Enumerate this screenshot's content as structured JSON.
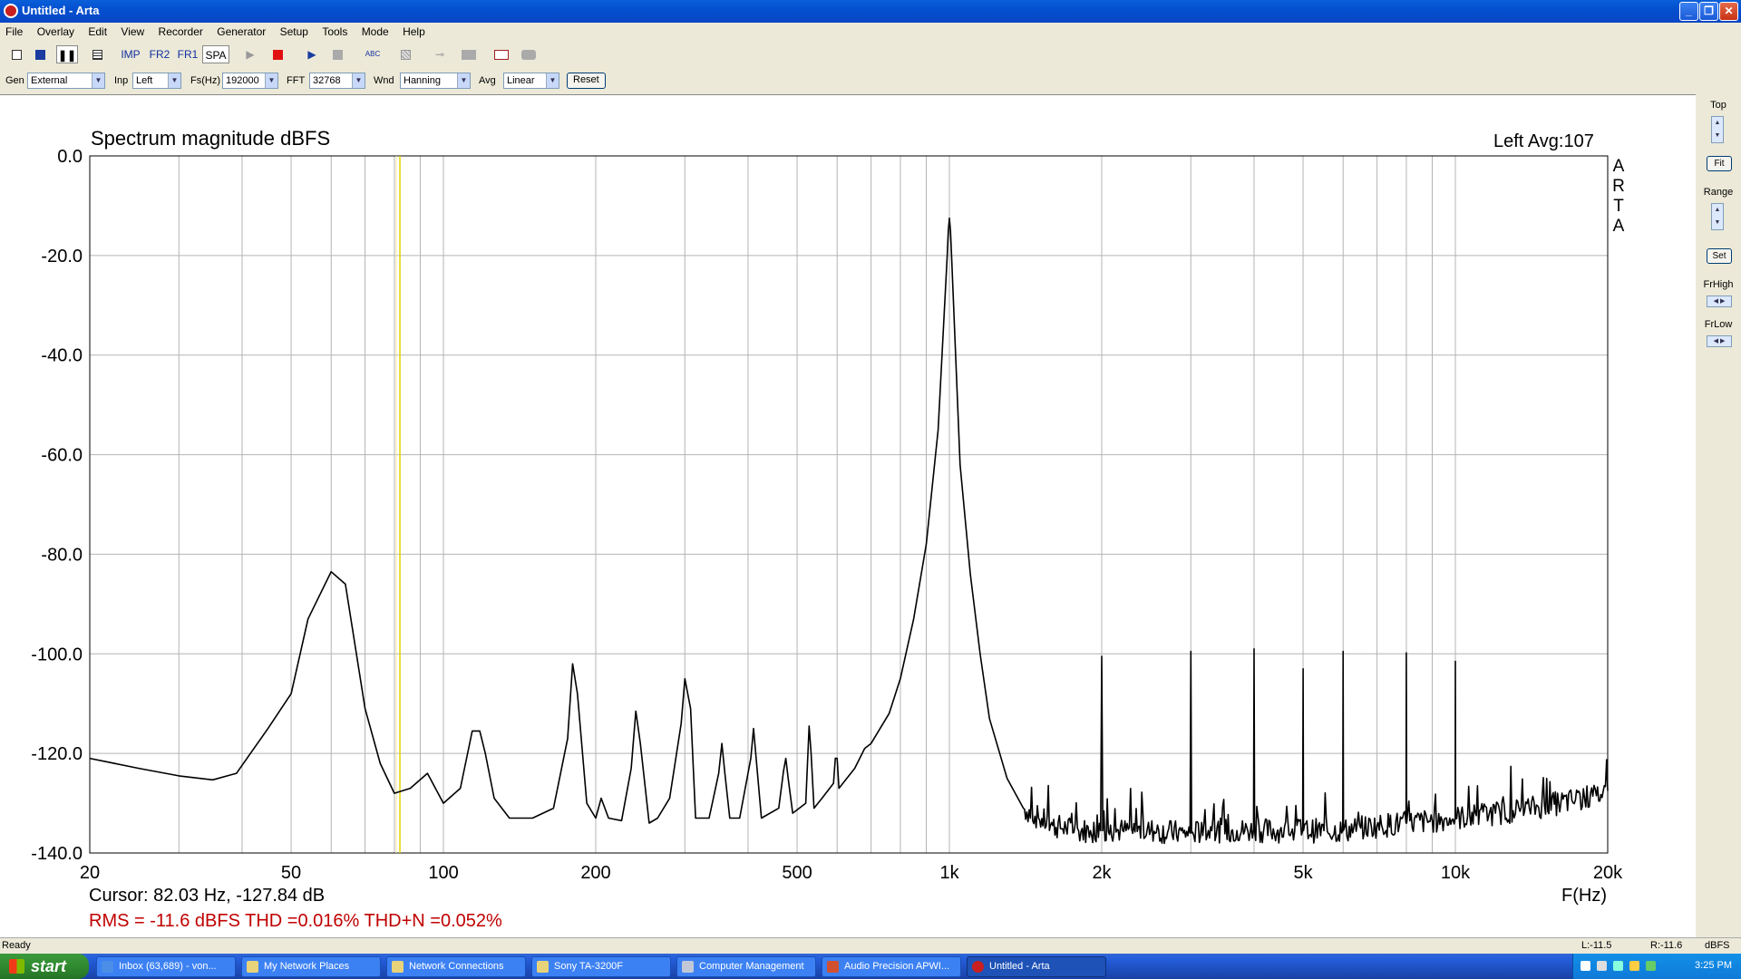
{
  "window": {
    "title": "Untitled - Arta",
    "btn_min": "_",
    "btn_max": "❐",
    "btn_close": "✕"
  },
  "menu": [
    "File",
    "Overlay",
    "Edit",
    "View",
    "Recorder",
    "Generator",
    "Setup",
    "Tools",
    "Mode",
    "Help"
  ],
  "toolbar": {
    "imp": "IMP",
    "fr2": "FR2",
    "fr1": "FR1",
    "spa": "SPA",
    "abc": "ABC"
  },
  "params": {
    "gen_label": "Gen",
    "gen_value": "External",
    "inp_label": "Inp",
    "inp_value": "Left",
    "fs_label": "Fs(Hz)",
    "fs_value": "192000",
    "fft_label": "FFT",
    "fft_value": "32768",
    "wnd_label": "Wnd",
    "wnd_value": "Hanning",
    "avg_label": "Avg",
    "avg_value": "Linear",
    "reset_label": "Reset"
  },
  "plot": {
    "title": "Spectrum magnitude dBFS",
    "status": "Left  Avg:107",
    "brand": [
      "A",
      "R",
      "T",
      "A"
    ],
    "cursor": "Cursor: 82.03 Hz, -127.84 dB",
    "measurements": "RMS =  -11.6 dBFS  THD =0.016%  THD+N =0.052%",
    "x_unit": "F(Hz)"
  },
  "right_panel": {
    "top": "Top",
    "fit": "Fit",
    "range": "Range",
    "set": "Set",
    "frhigh": "FrHigh",
    "frlow": "FrLow"
  },
  "statusbar": {
    "left": "Ready",
    "l_level": "L:-11.5",
    "r_level": "R:-11.6",
    "unit": "dBFS"
  },
  "taskbar": {
    "start": "start",
    "tasks": [
      "Inbox (63,689) - von...",
      "My Network Places",
      "Network Connections",
      "Sony TA-3200F",
      "Computer Management",
      "Audio Precision APWI...",
      "Untitled - Arta"
    ],
    "clock": "3:25 PM"
  },
  "colors": {
    "cursor_line": "#e6d200",
    "grid": "#b4b4b4",
    "trace": "#000000",
    "meas_text": "#c00000"
  },
  "chart_data": {
    "type": "line",
    "x_scale": "log",
    "xlim": [
      20,
      20000
    ],
    "ylim": [
      -140,
      0
    ],
    "x_ticks": [
      20,
      50,
      100,
      200,
      500,
      1000,
      2000,
      5000,
      10000,
      20000
    ],
    "x_tick_labels": [
      "20",
      "50",
      "100",
      "200",
      "500",
      "1k",
      "2k",
      "5k",
      "10k",
      "20k"
    ],
    "y_ticks": [
      0,
      -20,
      -40,
      -60,
      -80,
      -100,
      -120,
      -140
    ],
    "y_tick_labels": [
      "0.0",
      "-20.0",
      "-40.0",
      "-60.0",
      "-80.0",
      "-100.0",
      "-120.0",
      "-140.0"
    ],
    "cursor_hz": 82.03,
    "grid": true,
    "series": [
      {
        "x": [
          20,
          25,
          30,
          35,
          39,
          45,
          50,
          54,
          60,
          64,
          70,
          75,
          80,
          86,
          93,
          100,
          108,
          114,
          118,
          121,
          126,
          135,
          150,
          165,
          176,
          180,
          184,
          192,
          200,
          205,
          212,
          225,
          235,
          240,
          245,
          255,
          265,
          280,
          295,
          300,
          308,
          315,
          335,
          350,
          355,
          360,
          368,
          385,
          405,
          410,
          415,
          425,
          460,
          470,
          475,
          480,
          490,
          520,
          528,
          533,
          540,
          560,
          590,
          595,
          600,
          605,
          650,
          680,
          700,
          760,
          800,
          850,
          900,
          950,
          990,
          995,
          1000,
          1005,
          1010,
          1050,
          1100,
          1150,
          1200,
          1300,
          1400,
          1500,
          1600,
          1700,
          1800,
          1900,
          1990,
          2000,
          2010,
          2200,
          2500,
          2900,
          2990,
          3000,
          3010,
          3300,
          3700,
          3990,
          4000,
          4010,
          4500,
          4990,
          5000,
          5010,
          5500,
          5990,
          6000,
          6010,
          6500,
          7000,
          7990,
          8000,
          8010,
          9000,
          9990,
          10000,
          10010,
          11000,
          12000,
          13000,
          14000,
          15000,
          16000,
          17000,
          18000,
          19000,
          20000
        ],
        "y": [
          -121,
          -123,
          -124.5,
          -125.3,
          -124,
          -115,
          -108,
          -93,
          -83.5,
          -86,
          -111,
          -122,
          -128,
          -127,
          -124,
          -130,
          -127,
          -115.5,
          -115.5,
          -120,
          -129,
          -133,
          -133,
          -131,
          -117,
          -102,
          -108,
          -130,
          -133,
          -129,
          -133,
          -133.5,
          -123,
          -111.5,
          -118,
          -134,
          -133,
          -129,
          -114,
          -105,
          -111,
          -133,
          -133,
          -124,
          -118,
          -124,
          -133,
          -133,
          -121,
          -115,
          -121,
          -133,
          -131,
          -123.5,
          -121,
          -125,
          -132,
          -130,
          -114.5,
          -120,
          -131,
          -129,
          -126,
          -121,
          -121,
          -127,
          -123,
          -119,
          -118,
          -112,
          -105,
          -93,
          -78,
          -55,
          -20,
          -15,
          -12.5,
          -15,
          -20,
          -62,
          -84,
          -100,
          -113,
          -125,
          -131,
          -133,
          -134.5,
          -135,
          -135.5,
          -135.5,
          -135.5,
          -100.5,
          -135.5,
          -135.5,
          -135.5,
          -136,
          -136,
          -99.5,
          -136,
          -135.5,
          -135.5,
          -135.5,
          -99,
          -135.5,
          -135.5,
          -135.5,
          -103,
          -135.5,
          -135.5,
          -135.5,
          -99.5,
          -135.5,
          -135,
          -134.5,
          -134,
          -99.8,
          -134,
          -133.5,
          -133,
          -101.5,
          -133,
          -132.5,
          -132,
          -131.5,
          -131,
          -130.5,
          -130,
          -129.5,
          -129,
          -128.5,
          -127.5
        ]
      }
    ]
  }
}
